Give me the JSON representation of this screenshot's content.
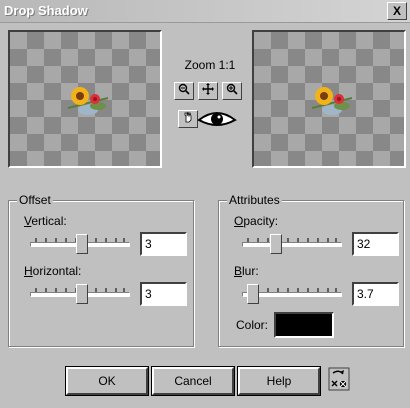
{
  "window": {
    "title": "Drop Shadow",
    "close_label": "X"
  },
  "preview": {
    "zoom_label": "Zoom 1:1"
  },
  "toolbar": {
    "zoom_out_icon": "zoom-out-icon",
    "pan_icon": "pan-icon",
    "zoom_in_icon": "zoom-in-icon",
    "hand_icon": "hand-icon",
    "eye_icon": "eye-icon"
  },
  "offset": {
    "group_label": "Offset",
    "vertical_label": "Vertical:",
    "vertical_value": "3",
    "vertical_fraction": 0.52,
    "horizontal_label": "Horizontal:",
    "horizontal_value": "3",
    "horizontal_fraction": 0.52
  },
  "attributes": {
    "group_label": "Attributes",
    "opacity_label": "Opacity:",
    "opacity_value": "32",
    "opacity_fraction": 0.32,
    "blur_label": "Blur:",
    "blur_value": "3.7",
    "blur_fraction": 0.06,
    "color_label": "Color:",
    "color_value": "#000000"
  },
  "buttons": {
    "ok": "OK",
    "cancel": "Cancel",
    "help": "Help",
    "reset_icon": "reset-icon"
  }
}
